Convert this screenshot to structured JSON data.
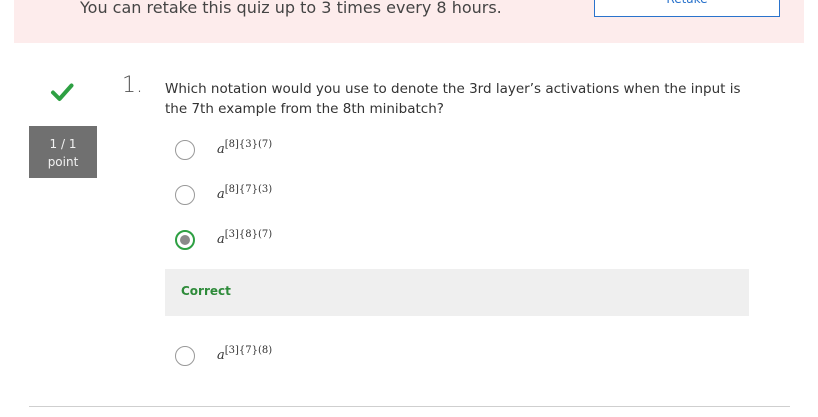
{
  "banner": {
    "message": "You can retake this quiz up to 3 times every 8 hours.",
    "retake_label": "Retake"
  },
  "question": {
    "number": "1.",
    "text": "Which notation would you use to denote the 3rd layer’s activations when the input is the 7th example from the 8th minibatch?",
    "score": "1 / 1",
    "score_unit": "point",
    "status_icon": "checkmark-icon",
    "options": [
      {
        "base": "a",
        "sup": "[8]{3}(7)",
        "selected": false
      },
      {
        "base": "a",
        "sup": "[8]{7}(3)",
        "selected": false
      },
      {
        "base": "a",
        "sup": "[3]{8}(7)",
        "selected": true
      },
      {
        "base": "a",
        "sup": "[3]{7}(8)",
        "selected": false
      }
    ],
    "feedback": "Correct"
  },
  "colors": {
    "correct": "#2ea043",
    "banner_bg": "#fdecec",
    "link": "#2a73cc"
  }
}
